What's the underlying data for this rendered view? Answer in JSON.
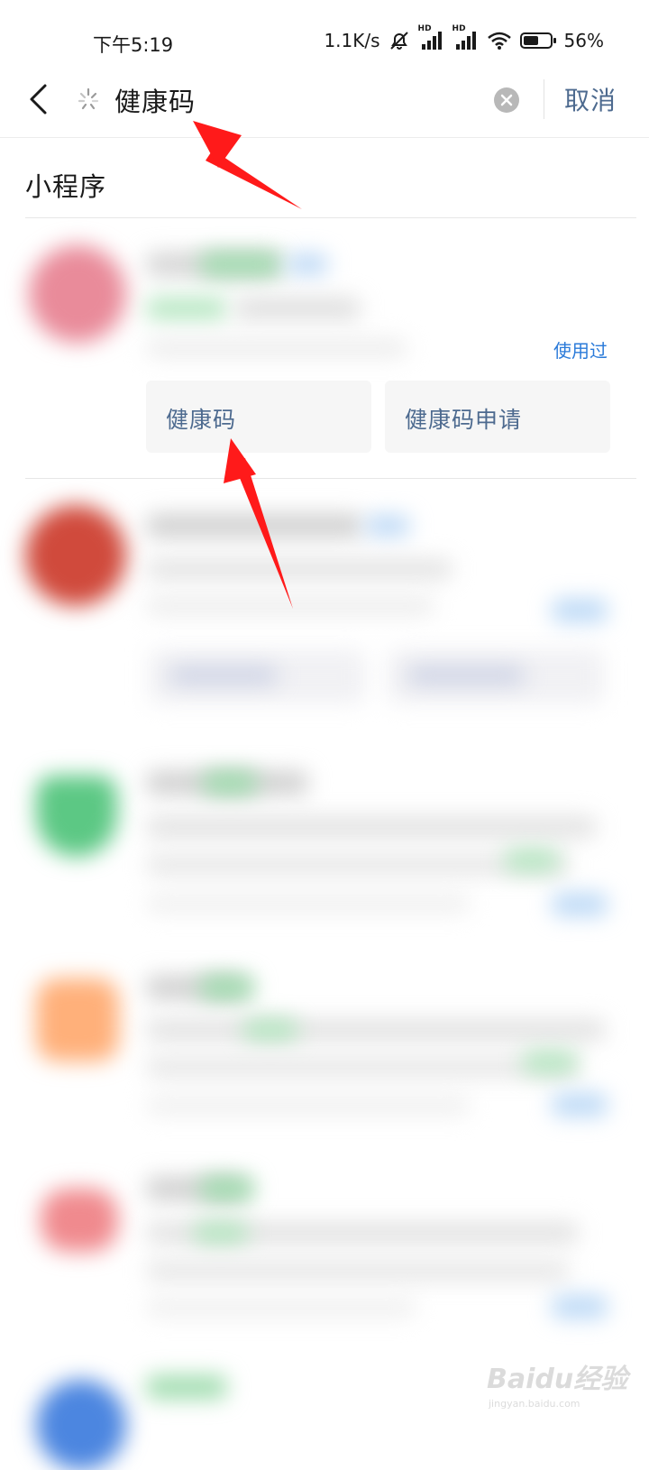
{
  "status_bar": {
    "time": "下午5:19",
    "net_speed": "1.1K/s",
    "hd1": "HD",
    "hd2": "HD",
    "battery": "56%",
    "icons": [
      "mute-bell-icon",
      "signal-icon",
      "signal-icon",
      "wifi-icon",
      "battery-icon"
    ]
  },
  "search": {
    "query": "健康码",
    "cancel_label": "取消",
    "icons": [
      "back-chevron-icon",
      "loading-spinner-icon",
      "clear-circle-icon"
    ]
  },
  "section": {
    "title": "小程序"
  },
  "results": {
    "first": {
      "badge": "使用过",
      "subitems": [
        "健康码",
        "健康码申请"
      ]
    }
  },
  "watermark": {
    "main": "Baidu经验",
    "sub": "jingyan.baidu.com"
  },
  "colors": {
    "accent_link": "#2a7ad9",
    "cancel_text": "#4d6a8f",
    "annotation_arrow": "#ff1a1a"
  }
}
